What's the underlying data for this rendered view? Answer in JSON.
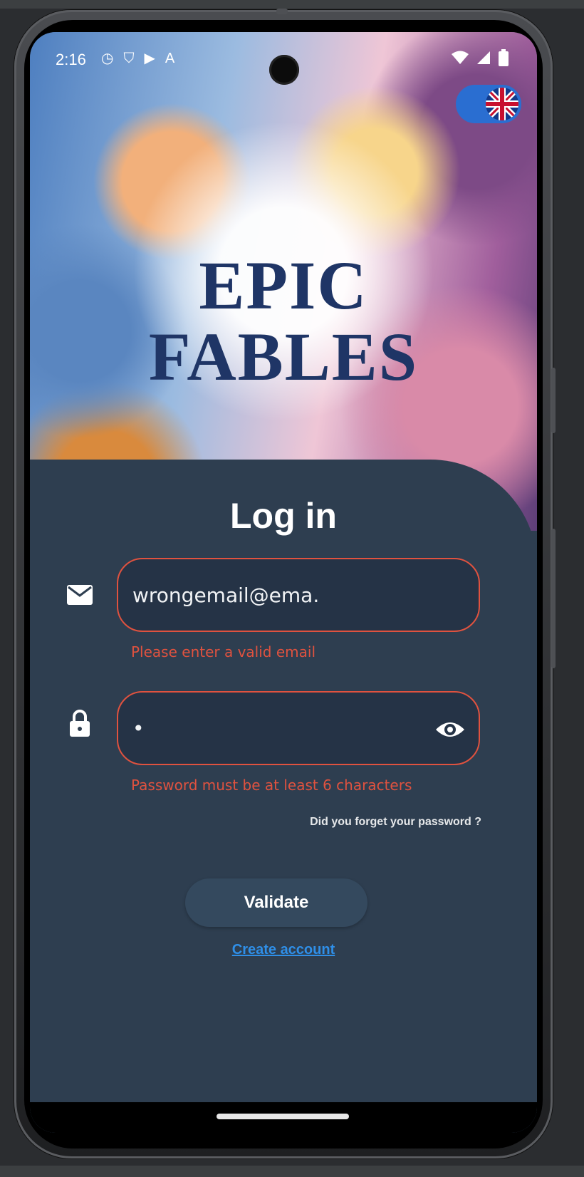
{
  "status_bar": {
    "time": "2:16"
  },
  "hero": {
    "title_line1": "EPIC",
    "title_line2": "FABLES"
  },
  "login": {
    "title": "Log in",
    "email": {
      "value": "wrongemail@ema.",
      "error": "Please enter a valid email"
    },
    "password": {
      "value": "•",
      "error": "Password must be at least 6 characters"
    },
    "forgot_label": "Did you forget your password ?",
    "validate_label": "Validate",
    "create_account_label": "Create account"
  },
  "colors": {
    "panel": "#2e3e50",
    "error": "#e0523f",
    "link": "#2f8fe8",
    "toggle": "#2a6ed1"
  },
  "icons": {
    "email": "mail-icon",
    "password": "lock-icon",
    "visibility": "eye-icon",
    "language": "uk-flag-icon"
  }
}
